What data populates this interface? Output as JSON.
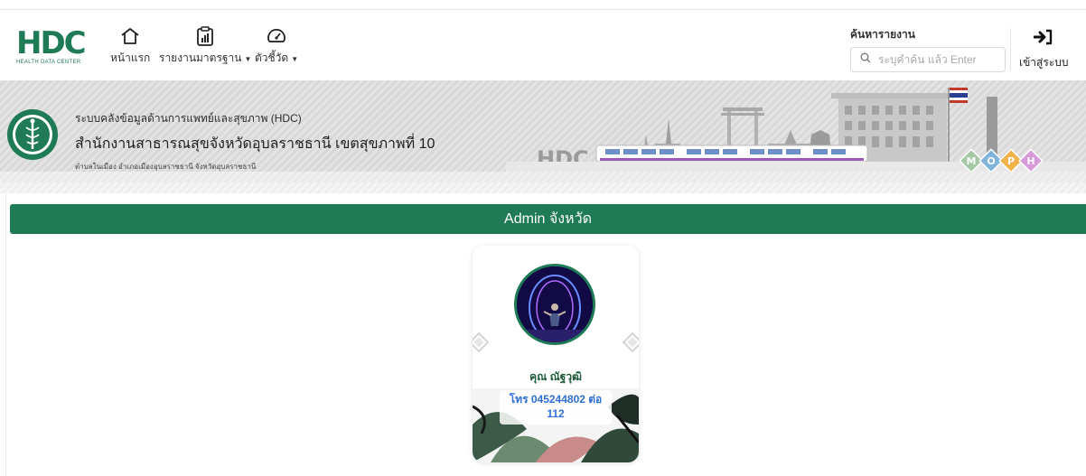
{
  "navbar": {
    "logo_text": "HDC",
    "logo_subtext": "HEALTH DATA CENTER",
    "home_label": "หน้าแรก",
    "reports_label": "รายงานมาตรฐาน",
    "indicators_label": "ตัวชี้วัด",
    "search_title": "ค้นหารายงาน",
    "search_placeholder": "ระบุคำค้น แล้ว Enter",
    "login_label": "เข้าสู่ระบบ"
  },
  "banner": {
    "line1": "ระบบคลังข้อมูลด้านการแพทย์และสุขภาพ (HDC)",
    "line2": "สำนักงานสาธารณสุขจังหวัดอุบลราชธานี เขตสุขภาพที่ 10",
    "line3": "ตำบลในเมือง อำเภอเมืองอุบลราชธานี จังหวัดอุบลราชธานี",
    "logo_text": "HDC",
    "mophs": [
      "M",
      "O",
      "P",
      "H"
    ]
  },
  "section": {
    "title": "Admin จังหวัด"
  },
  "card": {
    "name": "คุณ ณัฐวุฒิ",
    "phone_line1": "โทร 045244802 ต่อ",
    "phone_line2": "112"
  },
  "colors": {
    "primary": "#1f7a56",
    "phone": "#2f6fd6",
    "banner_bg": "#e0e0e0"
  }
}
